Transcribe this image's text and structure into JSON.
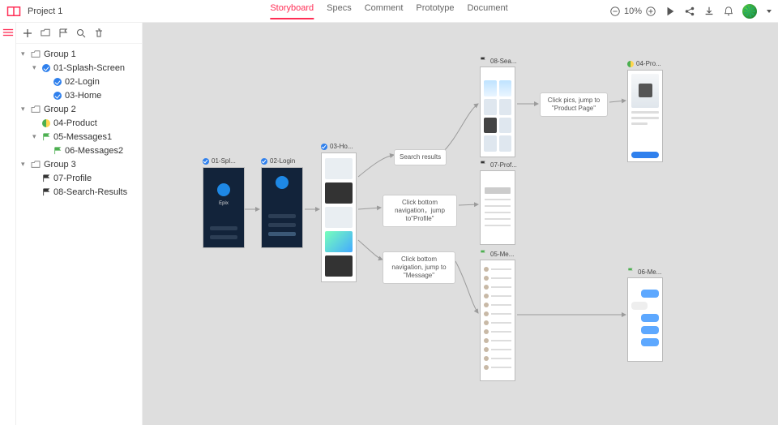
{
  "header": {
    "project_name": "Project 1",
    "tabs": [
      "Storyboard",
      "Specs",
      "Comment",
      "Prototype",
      "Document"
    ],
    "active_tab_index": 0,
    "zoom": "10%"
  },
  "sidebar": {
    "toolbar_icons": [
      "add",
      "folder",
      "flag",
      "search",
      "trash"
    ],
    "tree": [
      {
        "type": "group",
        "label": "Group 1",
        "expanded": true
      },
      {
        "type": "page",
        "icon": "check-blue",
        "label": "01-Splash-Screen",
        "indent": 1,
        "expanded": true
      },
      {
        "type": "page",
        "icon": "check-blue",
        "label": "02-Login",
        "indent": 2
      },
      {
        "type": "page",
        "icon": "check-blue",
        "label": "03-Home",
        "indent": 2
      },
      {
        "type": "group",
        "label": "Group 2",
        "expanded": true
      },
      {
        "type": "page",
        "icon": "half",
        "label": "04-Product",
        "indent": 1
      },
      {
        "type": "page",
        "icon": "flag-green",
        "label": "05-Messages1",
        "indent": 1,
        "expanded": true
      },
      {
        "type": "page",
        "icon": "flag-green",
        "label": "06-Messages2",
        "indent": 2
      },
      {
        "type": "group",
        "label": "Group 3",
        "expanded": true
      },
      {
        "type": "page",
        "icon": "flag-dark",
        "label": "07-Profile",
        "indent": 1
      },
      {
        "type": "page",
        "icon": "flag-dark",
        "label": "08-Search-Results",
        "indent": 1
      }
    ]
  },
  "canvas": {
    "nodes": {
      "splash": {
        "label": "01-Spl...",
        "icon": "check-blue"
      },
      "login": {
        "label": "02-Login",
        "icon": "check-blue"
      },
      "home": {
        "label": "03-Ho...",
        "icon": "check-blue"
      },
      "search": {
        "label": "08-Sea...",
        "icon": "flag-dark"
      },
      "profile": {
        "label": "07-Prof...",
        "icon": "flag-dark"
      },
      "messages": {
        "label": "05-Me...",
        "icon": "flag-green"
      },
      "product": {
        "label": "04-Pro...",
        "icon": "half"
      },
      "chat": {
        "label": "06-Me...",
        "icon": "flag-green"
      }
    },
    "notes": {
      "search_results": "Search results",
      "jump_profile": "Click bottom navigation，jump to\"Profile\"",
      "jump_message": "Click bottom navigation, jump to \"Message\"",
      "jump_product": "Click pics, jump to \"Product Page\""
    }
  }
}
